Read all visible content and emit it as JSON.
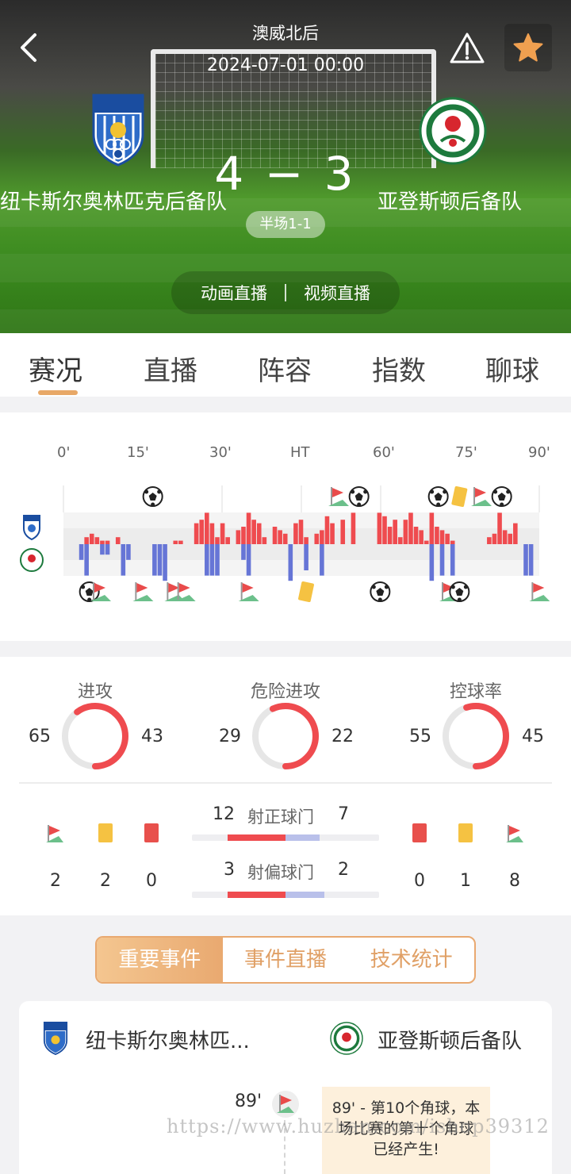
{
  "header": {
    "league": "澳威北后",
    "datetime": "2024-07-01 00:00",
    "score": "4 − 3",
    "half_score": "半场1-1",
    "live_animation": "动画直播",
    "live_video": "视频直播"
  },
  "teams": {
    "home": "纽卡斯尔奥林匹克后备队",
    "away": "亚登斯顿后备队",
    "home_short": "纽卡斯尔奥林匹...",
    "home_badge_text": "HAMILTON OLYMPIC FC",
    "away_badge_text": "Adamstown Rosebud FC"
  },
  "tabs": [
    "赛况",
    "直播",
    "阵容",
    "指数",
    "聊球"
  ],
  "timeline": {
    "ticks": [
      "0'",
      "15'",
      "30'",
      "HT",
      "60'",
      "75'",
      "90'"
    ],
    "home_events": [
      {
        "type": "goal",
        "minute": 16
      },
      {
        "type": "corner",
        "minute": 51
      },
      {
        "type": "goal",
        "minute": 55
      },
      {
        "type": "goal",
        "minute": 70
      },
      {
        "type": "yellow",
        "minute": 74
      },
      {
        "type": "corner",
        "minute": 78
      },
      {
        "type": "goal",
        "minute": 82
      }
    ],
    "away_events": [
      {
        "type": "goal",
        "minute": 4
      },
      {
        "type": "corner",
        "minute": 6
      },
      {
        "type": "corner",
        "minute": 14
      },
      {
        "type": "corner",
        "minute": 20
      },
      {
        "type": "corner",
        "minute": 22
      },
      {
        "type": "corner",
        "minute": 34
      },
      {
        "type": "yellow",
        "minute": 45
      },
      {
        "type": "goal",
        "minute": 59
      },
      {
        "type": "corner",
        "minute": 72
      },
      {
        "type": "goal",
        "minute": 74
      },
      {
        "type": "corner",
        "minute": 89
      }
    ],
    "home_pressure": [
      0,
      0,
      0,
      0,
      2,
      3,
      2,
      1,
      1,
      0,
      2,
      0,
      0,
      0,
      0,
      0,
      0,
      0,
      0,
      0,
      0,
      1,
      1,
      0,
      0,
      6,
      7,
      9,
      6,
      2,
      6,
      2,
      0,
      4,
      5,
      9,
      7,
      6,
      2,
      0,
      5,
      4,
      3,
      0,
      6,
      7,
      2,
      0,
      3,
      4,
      8,
      6,
      0,
      7,
      0,
      9,
      0,
      0,
      0,
      0,
      9,
      8,
      5,
      7,
      2,
      7,
      9,
      5,
      4,
      1,
      9,
      5,
      4,
      3,
      1,
      0,
      0,
      0,
      0,
      0,
      0,
      2,
      3,
      9,
      4,
      3,
      6,
      0,
      0,
      0,
      0
    ],
    "away_pressure": [
      0,
      0,
      0,
      3,
      6,
      0,
      0,
      2,
      2,
      0,
      0,
      6,
      3,
      0,
      0,
      0,
      0,
      6,
      6,
      7,
      0,
      0,
      0,
      0,
      0,
      0,
      0,
      6,
      6,
      6,
      0,
      0,
      0,
      0,
      3,
      6,
      0,
      0,
      0,
      0,
      0,
      0,
      0,
      7,
      0,
      0,
      5,
      0,
      0,
      6,
      0,
      0,
      0,
      0,
      0,
      0,
      0,
      0,
      0,
      0,
      0,
      0,
      0,
      0,
      0,
      0,
      0,
      0,
      0,
      0,
      7,
      0,
      6,
      0,
      6,
      0,
      0,
      0,
      0,
      0,
      0,
      0,
      0,
      0,
      0,
      0,
      0,
      0,
      6,
      6,
      0
    ],
    "colors": {
      "home": "#ef4b4f",
      "away": "#6675d6"
    }
  },
  "stats": {
    "attack": {
      "label": "进攻",
      "home": 65,
      "away": 43
    },
    "dangerous": {
      "label": "危险进攻",
      "home": 29,
      "away": 22
    },
    "possession": {
      "label": "控球率",
      "home": 55,
      "away": 45
    },
    "home_corners": "2",
    "home_yellow": "2",
    "home_red": "0",
    "away_red": "0",
    "away_yellow": "1",
    "away_corners": "8",
    "shots_on": {
      "label": "射正球门",
      "home": 12,
      "away": 7
    },
    "shots_off": {
      "label": "射偏球门",
      "home": 3,
      "away": 2
    }
  },
  "segments": [
    "重要事件",
    "事件直播",
    "技术统计"
  ],
  "events": {
    "minute": "89'",
    "line1": "89' - 第10个角球，本",
    "line2": "场比赛的第十个角球",
    "line3": "已经产生!"
  },
  "watermark": "https://www.huzhan.com/ishop39312"
}
